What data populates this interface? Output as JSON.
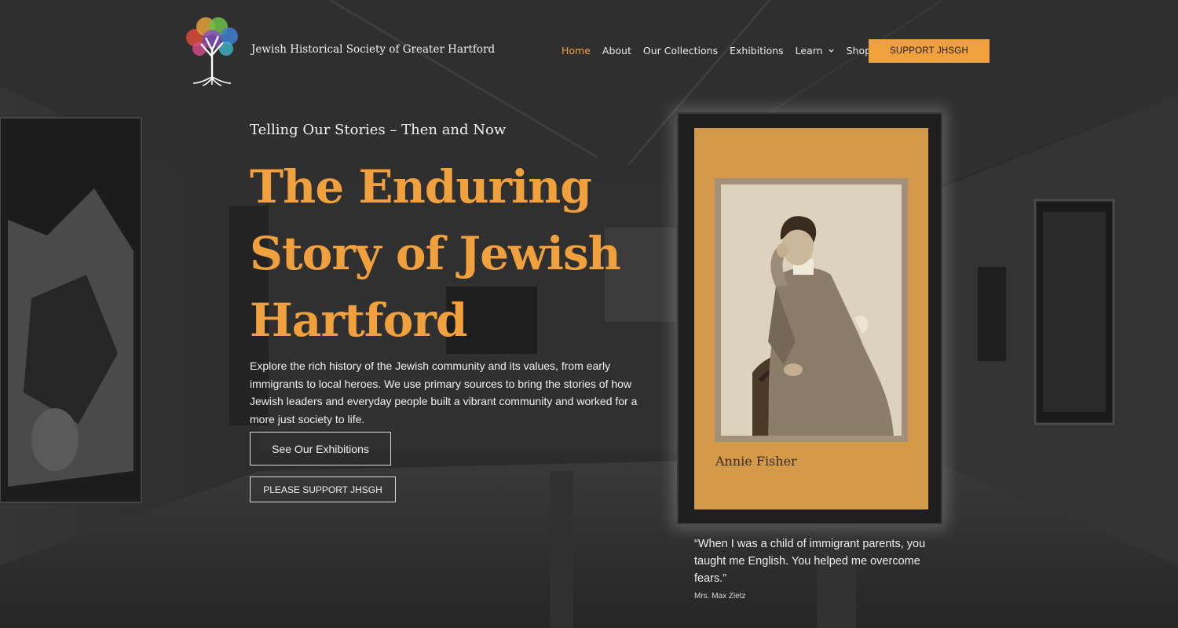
{
  "header": {
    "site_title": "Jewish Historical Society of Greater Hartford",
    "logo_icon": "tree-of-life-icon",
    "nav": [
      {
        "label": "Home",
        "active": true
      },
      {
        "label": "About"
      },
      {
        "label": "Our Collections"
      },
      {
        "label": "Exhibitions"
      },
      {
        "label": "Learn",
        "has_dropdown": true
      },
      {
        "label": "Shop",
        "has_dropdown": true
      }
    ],
    "support_button": "SUPPORT JHSGH"
  },
  "hero": {
    "tagline": "Telling Our Stories – Then and Now",
    "headline": "The Enduring Story of Jewish Hartford",
    "intro": "Explore the rich history of the Jewish community and its values, from early immigrants to local heroes. We use primary sources to bring the stories of how Jewish leaders and everyday people built a vibrant community and worked for a more just society to life.",
    "button_exhibitions": "See Our Exhibitions",
    "button_support": "PLEASE SUPPORT JHSGH"
  },
  "featured": {
    "name": "Annie Fisher",
    "quote": "“When I was a child of immigrant parents, you taught me English. You helped me overcome fears.”",
    "quote_author": "Mrs. Max Zietz"
  },
  "colors": {
    "accent": "#f0a03c",
    "frame_gold": "#d49a4a",
    "background": "#2a2a2a"
  }
}
